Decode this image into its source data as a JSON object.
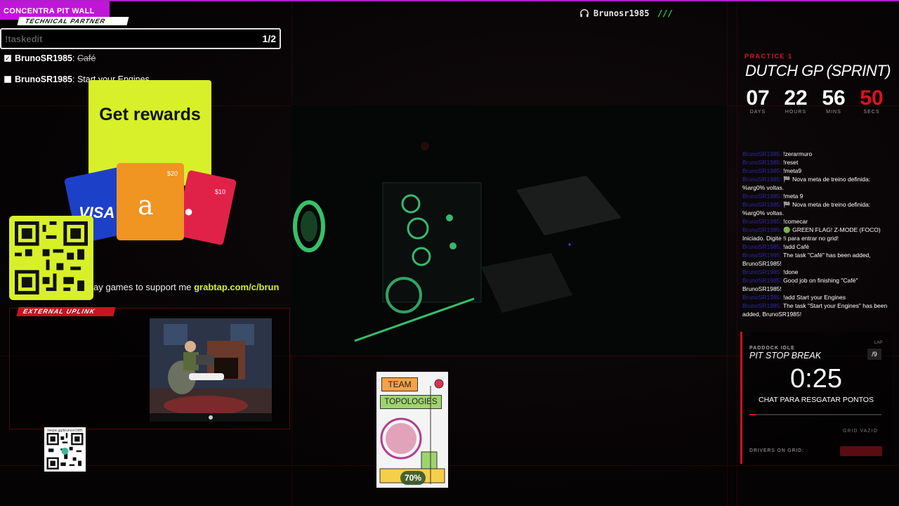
{
  "top_bar": {
    "brand": "CONCENTRA PIT WALL",
    "username": "Brunosr1985",
    "username_decor": "///"
  },
  "left_panel": {
    "partner_tag": "TECHNICAL PARTNER",
    "task_input_placeholder": "!taskedit",
    "task_count": "1/2",
    "tasks": [
      {
        "user": "BrunoSR1985",
        "separator": ":",
        "title": "Café",
        "done": true
      },
      {
        "user": "BrunoSR1985",
        "separator": ":",
        "title": "Start your Engines",
        "done": false
      }
    ],
    "rewards": {
      "headline": "Get rewards",
      "card_visa": "VISA",
      "card_amazon_value": "$20",
      "card_apple_value": "$10"
    },
    "support_text": "ay games to support me",
    "support_link": "grabtap.com/c/brun",
    "uplink_tag": "EXTERNAL UPLINK",
    "small_qr_url": "livepix.gg/brunosr1985"
  },
  "book": {
    "line1": "TEAM",
    "line2": "TOPOLOGIES",
    "progress": "70%"
  },
  "race": {
    "session": "PRACTICE 1",
    "title": "DUTCH GP (SPRINT)",
    "countdown": [
      {
        "value": "07",
        "unit": "DAYS"
      },
      {
        "value": "22",
        "unit": "HOURS"
      },
      {
        "value": "56",
        "unit": "MINS"
      },
      {
        "value": "50",
        "unit": "SECS"
      }
    ]
  },
  "chat": [
    {
      "user": "BrunoSR1985:",
      "text": "!zerarmuro"
    },
    {
      "user": "BrunoSR1985:",
      "text": "!reset"
    },
    {
      "user": "BrunoSR1985:",
      "text": "!meta9"
    },
    {
      "user": "BrunoSR1985:",
      "text": "🏁 Nova meta de treino definida: %arg0% voltas."
    },
    {
      "user": "BrunoSR1985:",
      "text": "!meta 9"
    },
    {
      "user": "BrunoSR1985:",
      "text": "🏁 Nova meta de treino definida: %arg0% voltas."
    },
    {
      "user": "BrunoSR1985:",
      "text": "!comecar"
    },
    {
      "user": "BrunoSR1985:",
      "text": "🟢 GREEN FLAG! Z-MODE (FOCO) Iniciado. Digite !i para entrar no grid!"
    },
    {
      "user": "BrunoSR1985:",
      "text": "!add Café"
    },
    {
      "user": "BrunoSR1985:",
      "text": "The task \"Café\" has been added, BrunoSR1985!"
    },
    {
      "user": "BrunoSR1985:",
      "text": "!done"
    },
    {
      "user": "BrunoSR1985:",
      "text": "Good job on finishing \"Café\" BrunoSR1985!"
    },
    {
      "user": "BrunoSR1985:",
      "text": "!add Start your Engines"
    },
    {
      "user": "BrunoSR1985:",
      "text": "The task \"Start your Engines\" has been added, BrunoSR1985!"
    }
  ],
  "pit": {
    "status": "PADDOCK IDLE",
    "title": "PIT STOP BREAK",
    "lap_label": "LAP",
    "lap_value": "/9",
    "timer": "0:25",
    "subtitle": "CHAT PARA RESGATAR PONTOS",
    "progress_fraction": 0.05,
    "grid_status": "GRID VAZIO",
    "drivers_label": "DRIVERS ON GRID:"
  },
  "colors": {
    "accent_magenta": "#c016d8",
    "accent_red": "#c8141e",
    "rewards_lime": "#d7f02a",
    "chat_user_blue": "#2a2aa0"
  }
}
